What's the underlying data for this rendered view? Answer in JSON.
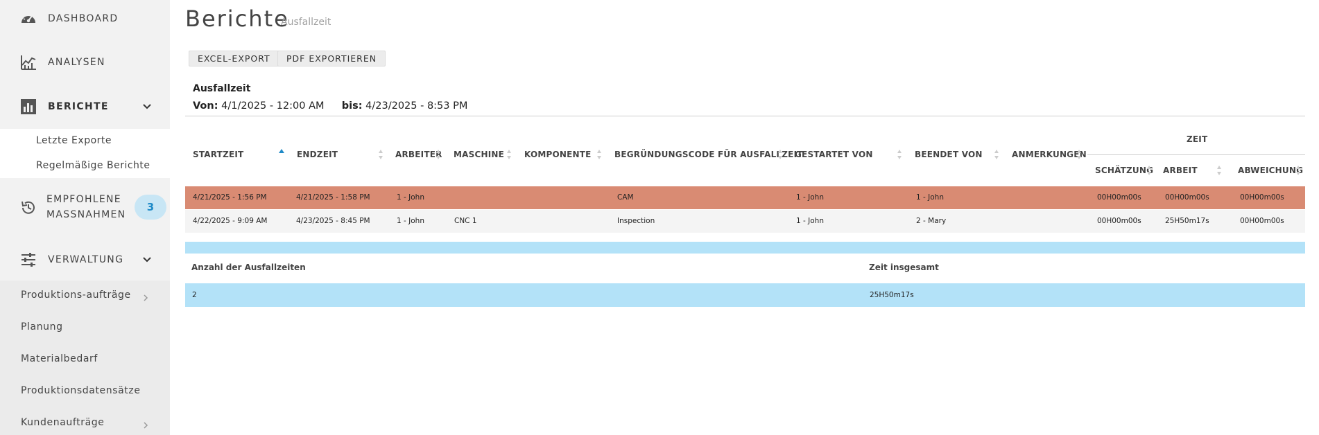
{
  "sidebar": {
    "nav": {
      "dashboard": "DASHBOARD",
      "analysen": "ANALYSEN",
      "berichte": "BERICHTE",
      "empfohlene_line1": "EMPFOHLENE",
      "empfohlene_line2": "MASSNAHMEN",
      "empfohlene_badge": "3",
      "verwaltung": "VERWALTUNG"
    },
    "berichte_sub": [
      "Letzte Exporte",
      "Regelmäßige Berichte"
    ],
    "admin_items": [
      "Produktions-aufträge",
      "Planung",
      "Materialbedarf",
      "Produktionsdatensätze",
      "Kundenaufträge"
    ]
  },
  "header": {
    "title": "Berichte",
    "subtitle": "Ausfallzeit"
  },
  "toolbar": {
    "excel": "EXCEL-EXPORT",
    "pdf": "PDF EXPORTIEREN"
  },
  "range": {
    "title": "Ausfallzeit",
    "from_label": "Von:",
    "from": "4/1/2025 - 12:00 AM",
    "to_label": "bis:",
    "to": "4/23/2025 - 8:53 PM"
  },
  "table": {
    "group_header": "ZEIT",
    "headers": {
      "startzeit": "STARTZEIT",
      "endzeit": "ENDZEIT",
      "arbeiter": "ARBEITER",
      "maschine": "MASCHINE",
      "komponente": "KOMPONENTE",
      "code": "BEGRÜNDUNGSCODE FÜR AUSFALLZEIT",
      "gestartet": "GESTARTET VON",
      "beendet": "BEENDET VON",
      "anmerkungen": "ANMERKUNGEN",
      "schaetzung": "SCHÄTZUNG",
      "arbeit": "ARBEIT",
      "abweichung": "ABWEICHUNG"
    },
    "rows": [
      {
        "start": "4/21/2025 - 1:56 PM",
        "end": "4/21/2025 - 1:58 PM",
        "worker": "1 - John",
        "machine": "",
        "component": "",
        "code": "CAM",
        "started_by": "1 - John",
        "ended_by": "1 - John",
        "notes": "",
        "estimate": "00H00m00s",
        "work": "00H00m00s",
        "deviation": "00H00m00s"
      },
      {
        "start": "4/22/2025 - 9:09 AM",
        "end": "4/23/2025 - 8:45 PM",
        "worker": "1 - John",
        "machine": "CNC 1",
        "component": "",
        "code": "Inspection",
        "started_by": "1 - John",
        "ended_by": "2 - Mary",
        "notes": "",
        "estimate": "00H00m00s",
        "work": "25H50m17s",
        "deviation": "00H00m00s"
      }
    ]
  },
  "summary": {
    "count_label": "Anzahl der Ausfallzeiten",
    "total_label": "Zeit insgesamt",
    "count": "2",
    "total": "25H50m17s"
  },
  "colors": {
    "highlight_row": "#d98b73",
    "accent_blue": "#b3e2f8",
    "badge_text": "#1f8ac7",
    "sort_active": "#1f8ac7"
  }
}
